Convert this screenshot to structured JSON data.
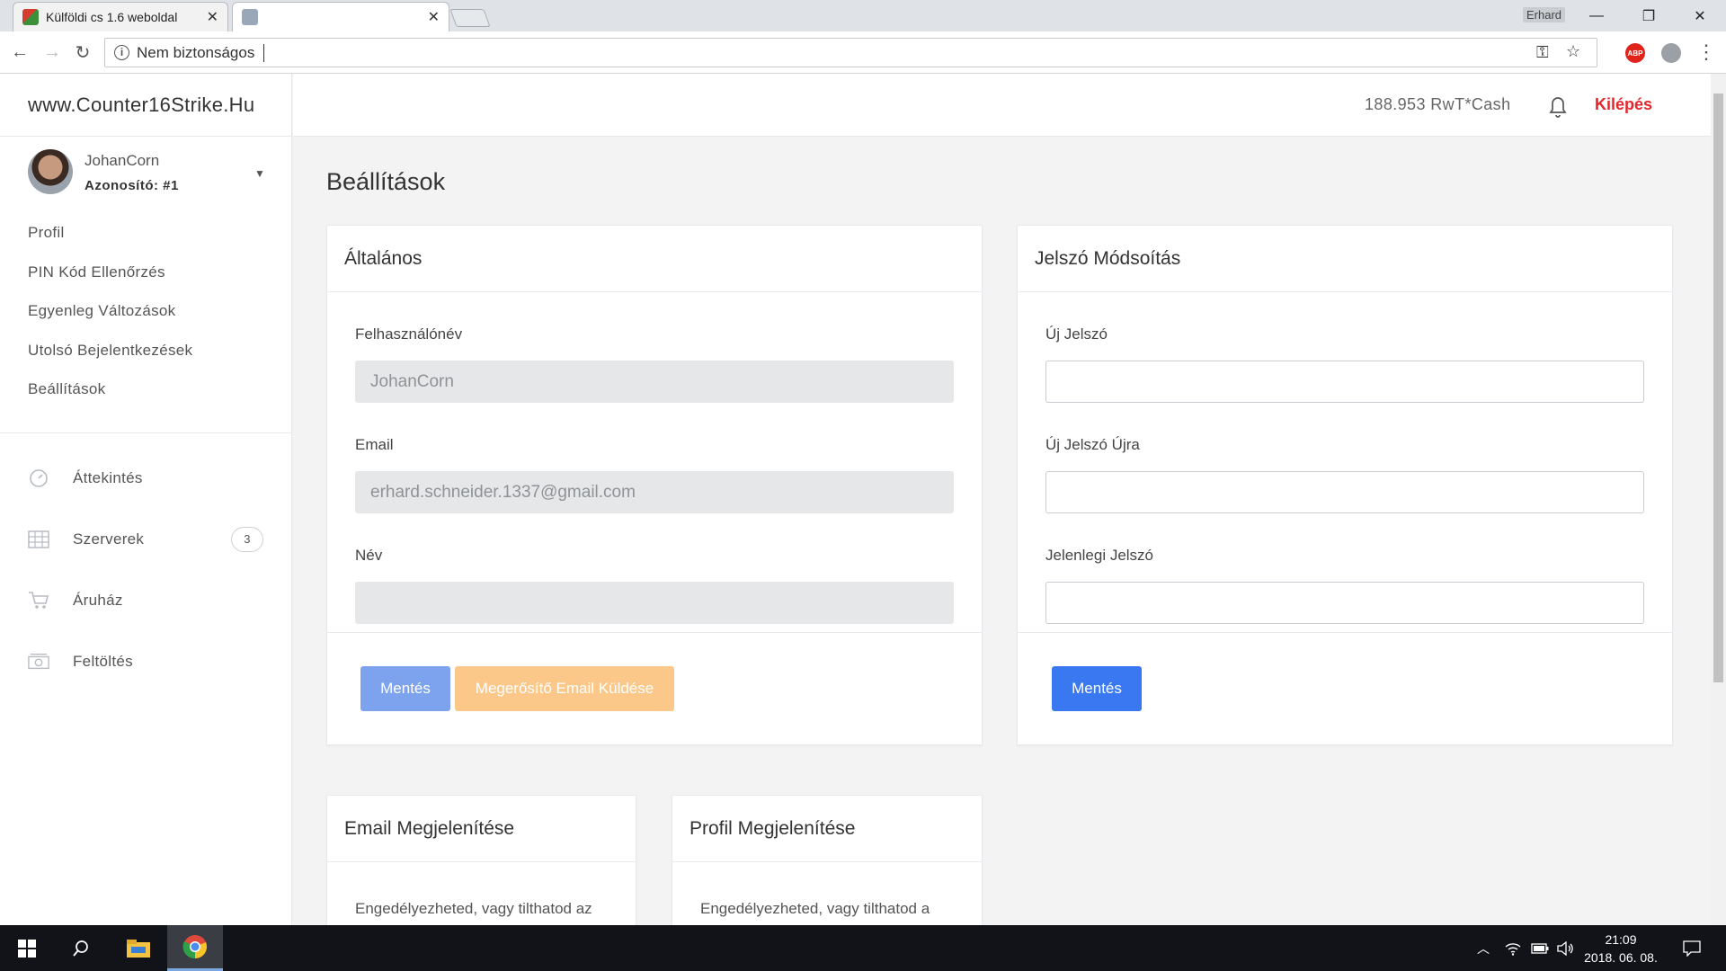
{
  "browser": {
    "tabs": [
      {
        "title": "Külföldi cs 1.6 weboldal",
        "active": false
      },
      {
        "title": "",
        "active": true
      }
    ],
    "profile_name": "Erhard",
    "address_text": "Nem biztonságos"
  },
  "site": {
    "brand": "www.Counter16Strike.Hu",
    "user": {
      "name": "JohanCorn",
      "id_label": "Azonosító: #1"
    },
    "menu_primary": [
      "Profil",
      "PIN Kód Ellenőrzés",
      "Egyenleg Változások",
      "Utolsó Bejelentkezések",
      "Beállítások"
    ],
    "menu_secondary": [
      {
        "label": "Áttekintés",
        "icon": "speedometer-icon"
      },
      {
        "label": "Szerverek",
        "icon": "grid-icon",
        "badge": "3"
      },
      {
        "label": "Áruház",
        "icon": "cart-icon"
      },
      {
        "label": "Feltöltés",
        "icon": "cash-icon"
      }
    ],
    "topbar": {
      "cash": "188.953 RwT*Cash",
      "logout": "Kilépés"
    }
  },
  "main": {
    "page_title": "Beállítások",
    "general": {
      "title": "Általános",
      "username_label": "Felhasználónév",
      "username_value": "JohanCorn",
      "email_label": "Email",
      "email_value": "erhard.schneider.1337@gmail.com",
      "name_label": "Név",
      "name_value": "",
      "save_label": "Mentés",
      "verify_label": "Megerősítő Email Küldése"
    },
    "password": {
      "title": "Jelszó Módsoítás",
      "new_label": "Új Jelszó",
      "repeat_label": "Új Jelszó Újra",
      "current_label": "Jelenlegi Jelszó",
      "save_label": "Mentés"
    },
    "email_display": {
      "title": "Email Megjelenítése",
      "desc": "Engedélyezheted, vagy tilthatod az"
    },
    "profile_display": {
      "title": "Profil Megjelenítése",
      "desc": "Engedélyezheted, vagy tilthatod a"
    }
  },
  "colors": {
    "accent_blue": "#3a78f2",
    "accent_blue_disabled": "#7da3ee",
    "accent_orange_disabled": "#fbc88a",
    "logout_red": "#e5252c"
  },
  "taskbar": {
    "time": "21:09",
    "date": "2018. 06. 08."
  }
}
